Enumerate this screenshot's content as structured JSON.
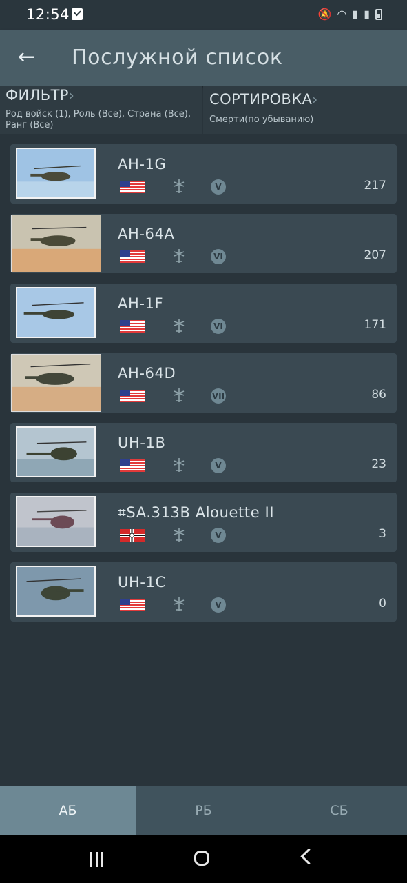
{
  "status_bar": {
    "time": "12:54"
  },
  "header": {
    "title": "Послужной список"
  },
  "filter": {
    "title": "ФИЛЬТР",
    "value": "Род войск (1), Роль (Все), Страна (Все), Ранг (Все)"
  },
  "sort": {
    "title": "СОРТИРОВКА",
    "value": "Смерти(по убыванию)"
  },
  "vehicles": [
    {
      "name": "AH-1G",
      "country": "usa",
      "rank": "V",
      "count": "217",
      "icon": "helicopter-icon"
    },
    {
      "name": "AH-64A",
      "country": "usa",
      "rank": "VI",
      "count": "207",
      "icon": "helicopter-icon"
    },
    {
      "name": "AH-1F",
      "country": "usa",
      "rank": "VI",
      "count": "171",
      "icon": "helicopter-icon"
    },
    {
      "name": "AH-64D",
      "country": "usa",
      "rank": "VII",
      "count": "86",
      "icon": "helicopter-icon"
    },
    {
      "name": "UH-1B",
      "country": "usa",
      "rank": "V",
      "count": "23",
      "icon": "helicopter-icon"
    },
    {
      "name": "⌗SA.313B Alouette II",
      "country": "germany",
      "rank": "V",
      "count": "3",
      "icon": "helicopter-icon"
    },
    {
      "name": "UH-1C",
      "country": "usa",
      "rank": "V",
      "count": "0",
      "icon": "helicopter-icon"
    }
  ],
  "tabs": [
    {
      "label": "АБ",
      "active": true
    },
    {
      "label": "РБ",
      "active": false
    },
    {
      "label": "СБ",
      "active": false
    }
  ],
  "colors": {
    "background": "#29343b",
    "app_bar": "#495d66",
    "row": "#3a4952",
    "tab_active": "#6d8894",
    "tab_bar": "#40535d"
  }
}
